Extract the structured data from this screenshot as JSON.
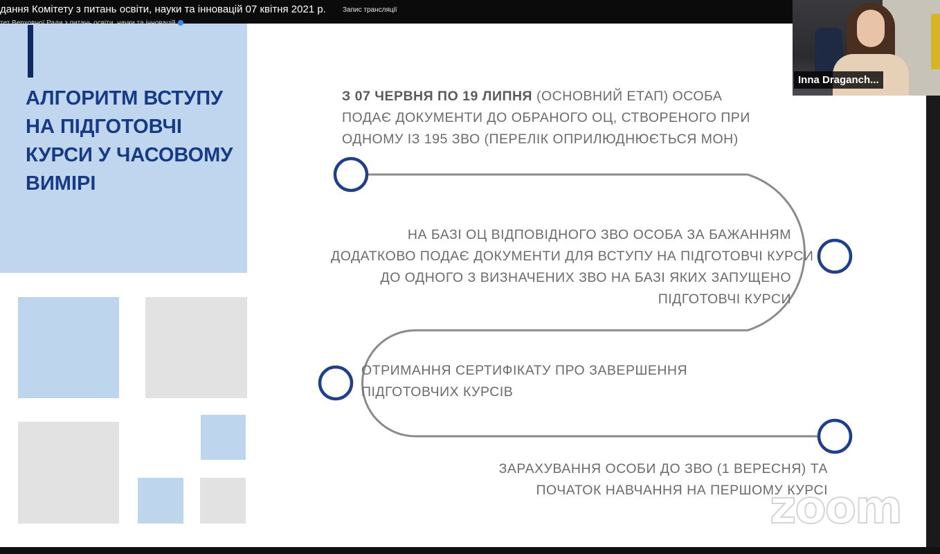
{
  "meeting": {
    "title": "дання Комітету з питань освіти, науки та інновацій 07 квітня 2021 р.",
    "record_label": "Запис трансляції",
    "channel": "тет Верховної Ради з питань освіти, науки та інновацій"
  },
  "slide": {
    "title": "АЛГОРИТМ ВСТУПУ НА ПІДГОТОВЧІ КУРСИ У ЧАСОВОМУ ВИМІРІ",
    "steps": [
      {
        "bold": "З 07 ЧЕРВНЯ ПО 19 ЛИПНЯ",
        "lines": [
          " (ОСНОВНИЙ ЕТАП) ОСОБА",
          "ПОДАЄ ДОКУМЕНТИ ДО ОБРАНОГО ОЦ, СТВОРЕНОГО ПРИ",
          "ОДНОМУ ІЗ 195 ЗВО (ПЕРЕЛІК ОПРИЛЮДНЮЄТЬСЯ МОН)"
        ]
      },
      {
        "lines": [
          "НА БАЗІ ОЦ ВІДПОВІДНОГО ЗВО ОСОБА ЗА БАЖАННЯМ",
          "ДОДАТКОВО ПОДАЄ ДОКУМЕНТИ ДЛЯ ВСТУПУ НА ПІДГОТОВЧІ КУРСИ",
          "ДО ОДНОГО З ВИЗНАЧЕНИХ ЗВО НА БАЗІ ЯКИХ ЗАПУЩЕНО",
          "ПІДГОТОВЧІ КУРСИ"
        ]
      },
      {
        "lines": [
          "ОТРИМАННЯ СЕРТИФІКАТУ ПРО ЗАВЕРШЕННЯ",
          "ПІДГОТОВЧИХ КУРСІВ"
        ]
      },
      {
        "lines": [
          "ЗАРАХУВАННЯ ОСОБИ ДО ЗВО (1 ВЕРЕСНЯ) ТА",
          "ПОЧАТОК НАВЧАННЯ НА ПЕРШОМУ КУРСІ"
        ]
      }
    ]
  },
  "participant": {
    "name": "Inna Draganch..."
  },
  "watermark": "zoom",
  "colors": {
    "title_blue": "#173a86",
    "panel_blue": "#c0d6ee",
    "node_blue": "#1f3f8a",
    "path_gray": "#8a8a8a"
  }
}
